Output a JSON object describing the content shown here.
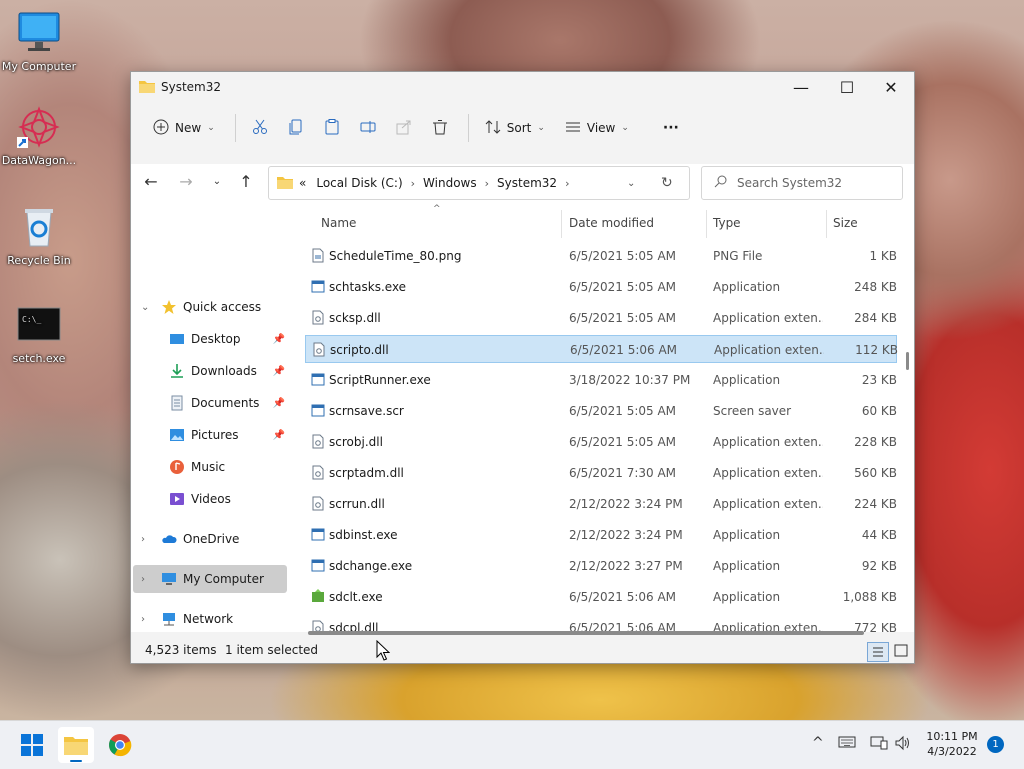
{
  "desktop": {
    "icons": [
      {
        "label": "My Computer"
      },
      {
        "label": "DataWagon..."
      },
      {
        "label": "Recycle Bin"
      },
      {
        "label": "setch.exe"
      }
    ]
  },
  "window": {
    "title": "System32",
    "controls": {
      "minimize": "—",
      "maximize": "☐",
      "close": "✕"
    }
  },
  "toolbar": {
    "new_label": "New",
    "sort_label": "Sort",
    "view_label": "View",
    "more_label": "···"
  },
  "address": {
    "prefix": "«",
    "crumbs": [
      "Local Disk (C:)",
      "Windows",
      "System32"
    ],
    "search_placeholder": "Search System32"
  },
  "nav": {
    "quick_access": "Quick access",
    "items": [
      {
        "label": "Desktop",
        "pinned": true
      },
      {
        "label": "Downloads",
        "pinned": true
      },
      {
        "label": "Documents",
        "pinned": true
      },
      {
        "label": "Pictures",
        "pinned": true
      },
      {
        "label": "Music",
        "pinned": false
      },
      {
        "label": "Videos",
        "pinned": false
      }
    ],
    "onedrive": "OneDrive",
    "my_computer": "My Computer",
    "network": "Network"
  },
  "columns": {
    "name": "Name",
    "date": "Date modified",
    "type": "Type",
    "size": "Size"
  },
  "files": [
    {
      "name": "ScheduleTime_80.png",
      "date": "6/5/2021 5:05 AM",
      "type": "PNG File",
      "size": "1 KB",
      "icon": "file-icon"
    },
    {
      "name": "schtasks.exe",
      "date": "6/5/2021 5:05 AM",
      "type": "Application",
      "size": "248 KB",
      "icon": "exe-icon"
    },
    {
      "name": "scksp.dll",
      "date": "6/5/2021 5:05 AM",
      "type": "Application exten...",
      "size": "284 KB",
      "icon": "dll-icon"
    },
    {
      "name": "scripto.dll",
      "date": "6/5/2021 5:06 AM",
      "type": "Application exten...",
      "size": "112 KB",
      "icon": "dll-icon",
      "selected": true
    },
    {
      "name": "ScriptRunner.exe",
      "date": "3/18/2022 10:37 PM",
      "type": "Application",
      "size": "23 KB",
      "icon": "exe-icon"
    },
    {
      "name": "scrnsave.scr",
      "date": "6/5/2021 5:05 AM",
      "type": "Screen saver",
      "size": "60 KB",
      "icon": "exe-icon"
    },
    {
      "name": "scrobj.dll",
      "date": "6/5/2021 5:05 AM",
      "type": "Application exten...",
      "size": "228 KB",
      "icon": "dll-icon"
    },
    {
      "name": "scrptadm.dll",
      "date": "6/5/2021 7:30 AM",
      "type": "Application exten...",
      "size": "560 KB",
      "icon": "dll-icon"
    },
    {
      "name": "scrrun.dll",
      "date": "2/12/2022 3:24 PM",
      "type": "Application exten...",
      "size": "224 KB",
      "icon": "dll-icon"
    },
    {
      "name": "sdbinst.exe",
      "date": "2/12/2022 3:24 PM",
      "type": "Application",
      "size": "44 KB",
      "icon": "exe-icon"
    },
    {
      "name": "sdchange.exe",
      "date": "2/12/2022 3:27 PM",
      "type": "Application",
      "size": "92 KB",
      "icon": "exe-icon"
    },
    {
      "name": "sdclt.exe",
      "date": "6/5/2021 5:06 AM",
      "type": "Application",
      "size": "1,088 KB",
      "icon": "backup-exe-icon"
    },
    {
      "name": "sdcpl.dll",
      "date": "6/5/2021 5:06 AM",
      "type": "Application exten...",
      "size": "772 KB",
      "icon": "dll-icon"
    }
  ],
  "status": {
    "item_count": "4,523 items",
    "selected": "1 item selected"
  },
  "taskbar": {
    "clock_time": "10:11 PM",
    "clock_date": "4/3/2022",
    "notifications": "1"
  },
  "colors": {
    "accent": "#0067c0",
    "selection_bg": "#cce4f7",
    "selection_border": "#99c9ef",
    "folder": "#f4c542"
  }
}
